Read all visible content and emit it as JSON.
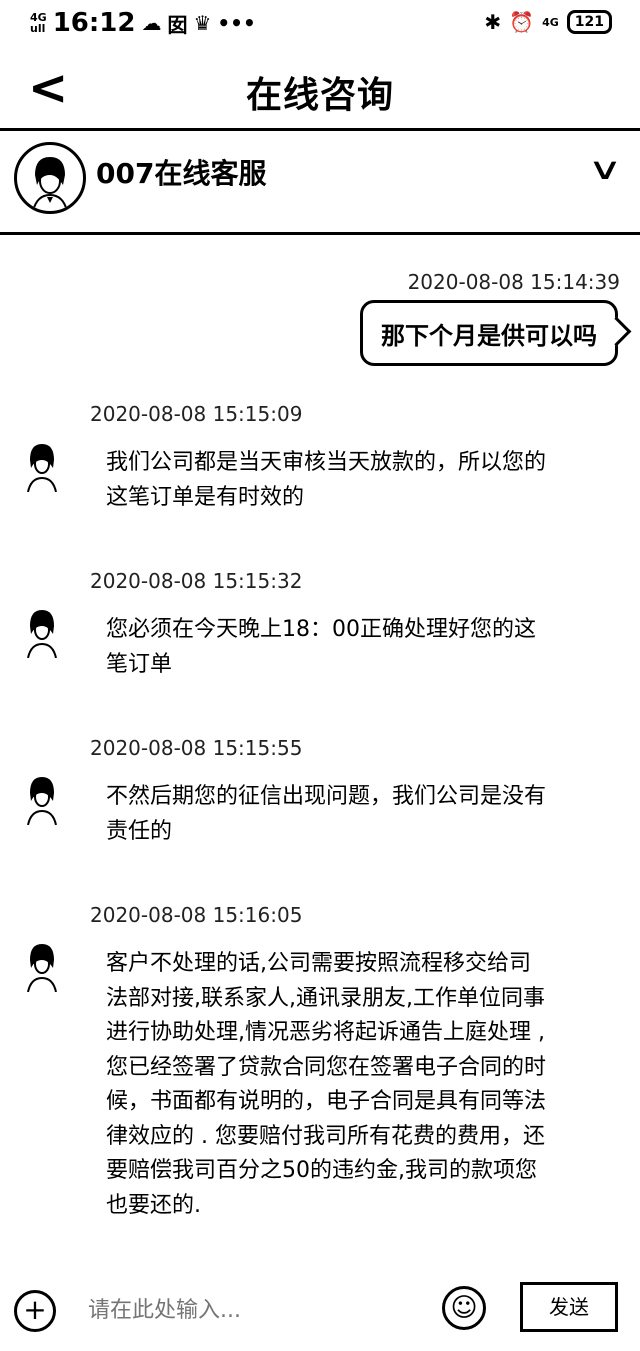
{
  "status_bar": {
    "network_top": "4G",
    "network_bottom": "ull",
    "time": "16:12",
    "left_icons": [
      "☁",
      "囡",
      "♛",
      "•••"
    ],
    "bluetooth": "✱",
    "alarm": "⏰",
    "signal": "4G",
    "battery": "121"
  },
  "nav": {
    "back_glyph": "<",
    "title": "在线咨询"
  },
  "agent": {
    "name": "007在线客服",
    "chevron": "∨"
  },
  "messages": [
    {
      "direction": "out",
      "timestamp": "2020-08-08 15:14:39",
      "text": "那下个月是供可以吗"
    },
    {
      "direction": "in",
      "timestamp": "2020-08-08 15:15:09",
      "text": "我们公司都是当天审核当天放款的，所以您的这笔订单是有时效的"
    },
    {
      "direction": "in",
      "timestamp": "2020-08-08 15:15:32",
      "text": "您必须在今天晚上18：00正确处理好您的这笔订单"
    },
    {
      "direction": "in",
      "timestamp": "2020-08-08 15:15:55",
      "text": "不然后期您的征信出现问题，我们公司是没有责任的"
    },
    {
      "direction": "in",
      "timestamp": "2020-08-08 15:16:05",
      "text": "客户不处理的话,公司需要按照流程移交给司法部对接,联系家人,通讯录朋友,工作单位同事进行协助处理,情况恶劣将起诉通告上庭处理 ,您已经签署了贷款合同您在签署电子合同的时候，书面都有说明的，电子合同是具有同等法律效应的 . 您要赔付我司所有花费的费用，还要赔偿我司百分之50的违约金,我司的款项您也要还的."
    }
  ],
  "input_bar": {
    "plus": "+",
    "placeholder": "请在此处输入...",
    "emoji": "☺",
    "send_label": "发送"
  }
}
